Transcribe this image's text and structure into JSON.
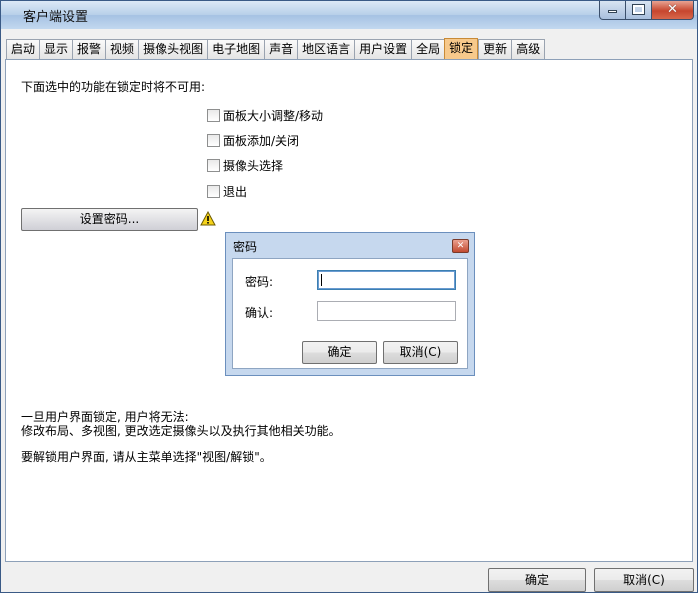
{
  "window": {
    "title": "客户端设置"
  },
  "tabs": [
    {
      "label": "启动"
    },
    {
      "label": "显示"
    },
    {
      "label": "报警"
    },
    {
      "label": "视频"
    },
    {
      "label": "摄像头视图"
    },
    {
      "label": "电子地图"
    },
    {
      "label": "声音"
    },
    {
      "label": "地区语言"
    },
    {
      "label": "用户设置"
    },
    {
      "label": "全局"
    },
    {
      "label": "锁定",
      "active": true
    },
    {
      "label": "更新"
    },
    {
      "label": "高级"
    }
  ],
  "lock": {
    "description": "下面选中的功能在锁定时将不可用:",
    "options": [
      {
        "label": "面板大小调整/移动",
        "checked": false
      },
      {
        "label": "面板添加/关闭",
        "checked": false
      },
      {
        "label": "摄像头选择",
        "checked": false
      },
      {
        "label": "退出",
        "checked": false
      }
    ],
    "set_password_label": "设置密码...",
    "info_line1": "一旦用户界面锁定, 用户将无法:",
    "info_line2": "修改布局、多视图, 更改选定摄像头以及执行其他相关功能。",
    "info_line3": "要解锁用户界面, 请从主菜单选择\"视图/解锁\"。"
  },
  "password_dialog": {
    "title": "密码",
    "password_label": "密码:",
    "confirm_label": "确认:",
    "password_value": "",
    "confirm_value": "",
    "ok_label": "确定",
    "cancel_label": "取消(C)"
  },
  "footer": {
    "ok_label": "确定",
    "cancel_label": "取消(C)"
  },
  "colors": {
    "active_tab": "#f7c98b",
    "title_gradient": "#b7cfe9",
    "close_red": "#c7462e"
  }
}
